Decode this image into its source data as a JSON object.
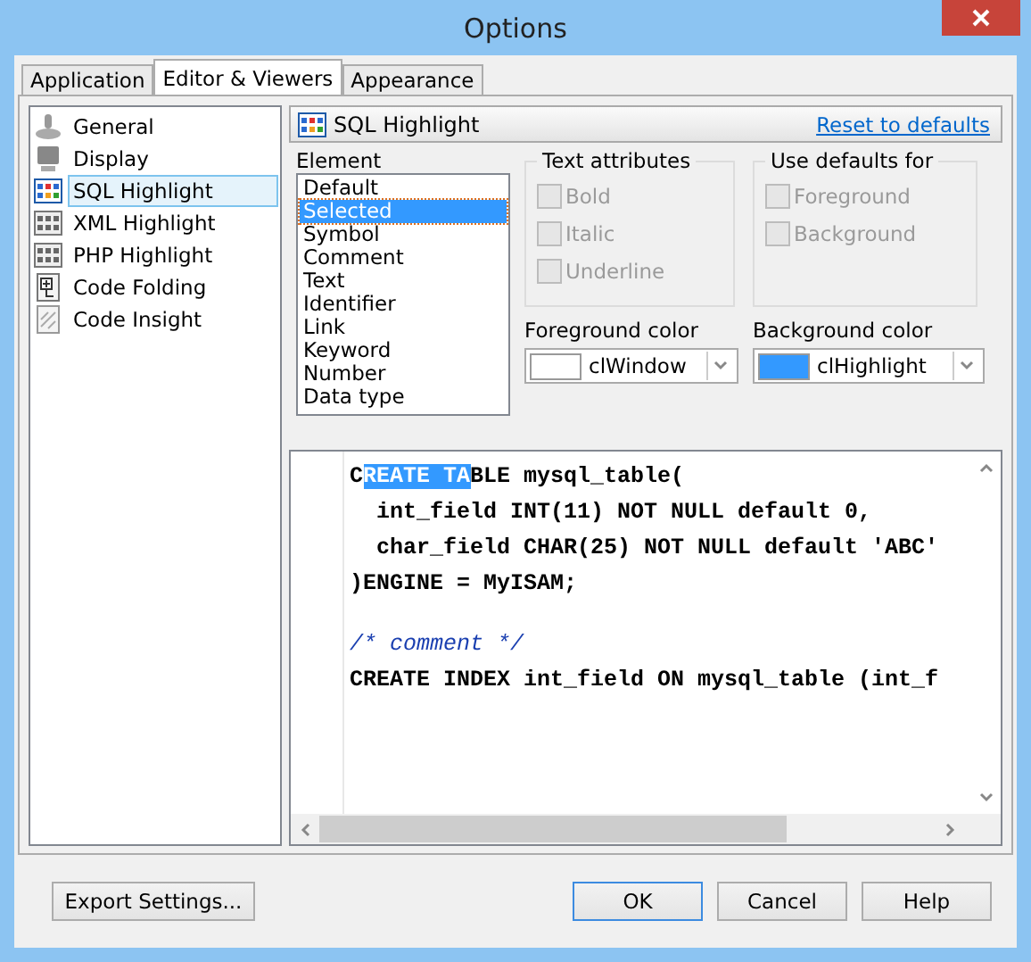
{
  "window": {
    "title": "Options"
  },
  "tabs": [
    {
      "label": "Application",
      "selected": false
    },
    {
      "label": "Editor & Viewers",
      "selected": true
    },
    {
      "label": "Appearance",
      "selected": false
    }
  ],
  "sidebar": {
    "items": [
      {
        "label": "General",
        "selected": false
      },
      {
        "label": "Display",
        "selected": false
      },
      {
        "label": "SQL Highlight",
        "selected": true
      },
      {
        "label": "XML Highlight",
        "selected": false
      },
      {
        "label": "PHP Highlight",
        "selected": false
      },
      {
        "label": "Code Folding",
        "selected": false
      },
      {
        "label": "Code Insight",
        "selected": false
      }
    ]
  },
  "header": {
    "title": "SQL Highlight",
    "reset_link": "Reset to defaults"
  },
  "element": {
    "label": "Element",
    "items": [
      {
        "label": "Default",
        "selected": false
      },
      {
        "label": "Selected",
        "selected": true
      },
      {
        "label": "Symbol",
        "selected": false
      },
      {
        "label": "Comment",
        "selected": false
      },
      {
        "label": "Text",
        "selected": false
      },
      {
        "label": "Identifier",
        "selected": false
      },
      {
        "label": "Link",
        "selected": false
      },
      {
        "label": "Keyword",
        "selected": false
      },
      {
        "label": "Number",
        "selected": false
      },
      {
        "label": "Data type",
        "selected": false
      }
    ]
  },
  "text_attributes": {
    "title": "Text attributes",
    "options": [
      {
        "label": "Bold",
        "checked": false,
        "disabled": true
      },
      {
        "label": "Italic",
        "checked": false,
        "disabled": true
      },
      {
        "label": "Underline",
        "checked": false,
        "disabled": true
      }
    ]
  },
  "use_defaults": {
    "title": "Use defaults for",
    "options": [
      {
        "label": "Foreground",
        "checked": false,
        "disabled": true
      },
      {
        "label": "Background",
        "checked": false,
        "disabled": true
      }
    ]
  },
  "foreground": {
    "label": "Foreground color",
    "value": "clWindow",
    "color": "#ffffff"
  },
  "background": {
    "label": "Background color",
    "value": "clHighlight",
    "color": "#3399ff"
  },
  "code": {
    "lines": [
      {
        "kind": "code",
        "parts": [
          {
            "text": "C",
            "selected": false
          },
          {
            "text": "REATE TA",
            "selected": true
          },
          {
            "text": "BLE mysql_table(",
            "selected": false
          }
        ]
      },
      {
        "kind": "code",
        "parts": [
          {
            "text": "  int_field INT(11) NOT NULL default 0,",
            "selected": false
          }
        ]
      },
      {
        "kind": "code",
        "parts": [
          {
            "text": "  char_field CHAR(25) NOT NULL default 'ABC'",
            "selected": false
          }
        ]
      },
      {
        "kind": "code",
        "parts": [
          {
            "text": ")ENGINE = MyISAM;",
            "selected": false
          }
        ]
      },
      {
        "kind": "blank"
      },
      {
        "kind": "comment",
        "parts": [
          {
            "text": "/* comment */",
            "selected": false
          }
        ]
      },
      {
        "kind": "code",
        "parts": [
          {
            "text": "CREATE INDEX int_field ON mysql_table (int_f",
            "selected": false
          }
        ]
      }
    ]
  },
  "buttons": [
    {
      "label": "Export Settings...",
      "kind": "left",
      "default": false
    },
    {
      "label": "OK",
      "kind": "right",
      "default": true
    },
    {
      "label": "Cancel",
      "kind": "right",
      "default": false
    },
    {
      "label": "Help",
      "kind": "right",
      "default": false
    }
  ]
}
